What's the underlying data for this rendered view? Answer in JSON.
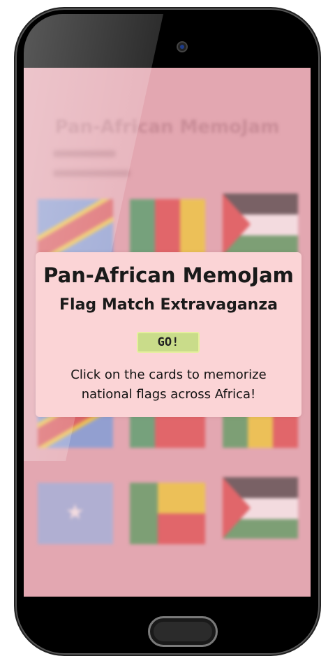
{
  "screen": {
    "background_title": "Pan-African MemoJam",
    "card_flags": [
      "DR Congo",
      "Cameroon",
      "Western Sahara",
      "DR Congo",
      "Cameroon",
      "Guinea",
      "Somalia-like",
      "Benin",
      "Western Sahara"
    ]
  },
  "overlay": {
    "title": "Pan-African MemoJam",
    "subtitle": "Flag Match Extravaganza",
    "go_label": "GO!",
    "description": "Click on the cards to memorize national flags across Africa!"
  },
  "colors": {
    "screen_tint": "#e3a7b1",
    "overlay_bg": "#fbd4d6",
    "go_button": "#c9dc8a"
  }
}
